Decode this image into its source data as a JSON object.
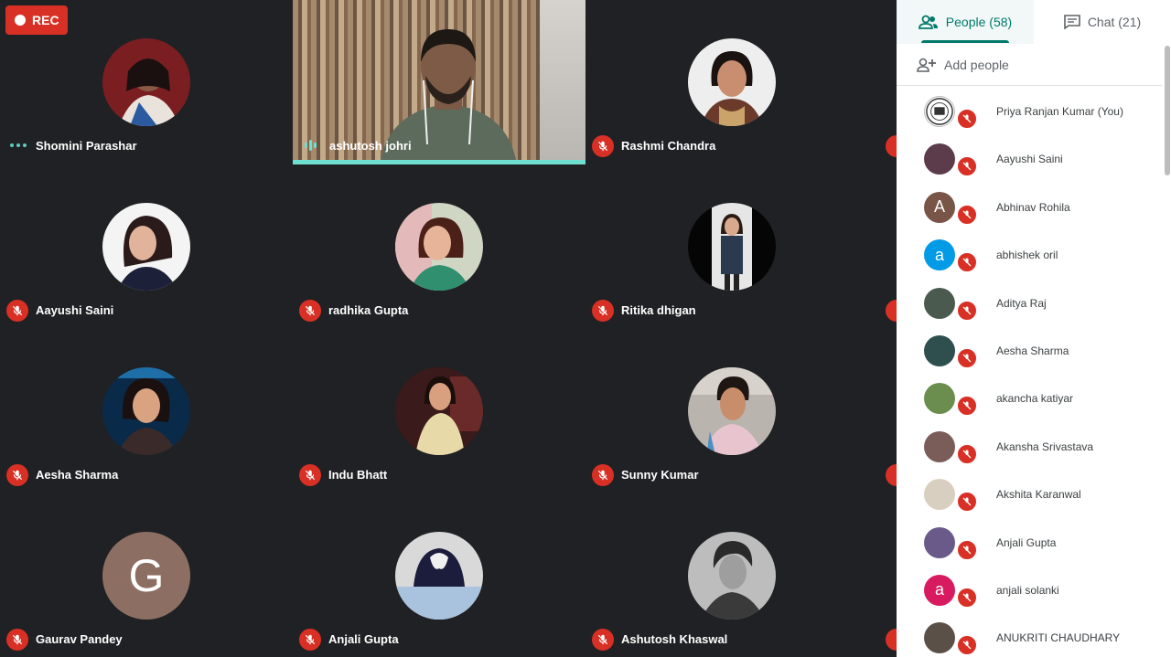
{
  "recording": {
    "label": "REC"
  },
  "grid": {
    "tiles": [
      {
        "name": "Shomini Parashar",
        "status": "dots"
      },
      {
        "name": "ashutosh johri",
        "status": "speaking"
      },
      {
        "name": "Rashmi Chandra",
        "status": "muted"
      },
      {
        "name": "Aayushi Saini",
        "status": "muted"
      },
      {
        "name": "radhika Gupta",
        "status": "muted"
      },
      {
        "name": "Ritika dhigan",
        "status": "muted"
      },
      {
        "name": "Aesha Sharma",
        "status": "muted"
      },
      {
        "name": "Indu Bhatt",
        "status": "muted"
      },
      {
        "name": "Sunny Kumar",
        "status": "muted"
      },
      {
        "name": "Gaurav Pandey",
        "status": "muted",
        "initial": "G",
        "color": "#8d6e63"
      },
      {
        "name": "Anjali Gupta",
        "status": "muted"
      },
      {
        "name": "Ashutosh Khaswal",
        "status": "muted"
      }
    ]
  },
  "panel": {
    "tabs": {
      "people": "People (58)",
      "chat": "Chat (21)"
    },
    "add_people": "Add people",
    "participants": [
      {
        "name": "Priya Ranjan Kumar (You)",
        "avatar": "logo"
      },
      {
        "name": "Aayushi Saini",
        "avatar": "photo",
        "color": "#5c3b4a"
      },
      {
        "name": "Abhinav Rohila",
        "avatar": "initial",
        "initial": "A",
        "color": "#795548"
      },
      {
        "name": "abhishek oril",
        "avatar": "initial",
        "initial": "a",
        "color": "#039be5"
      },
      {
        "name": "Aditya Raj",
        "avatar": "photo",
        "color": "#4a5a4f"
      },
      {
        "name": "Aesha Sharma",
        "avatar": "photo",
        "color": "#2f4f4f"
      },
      {
        "name": "akancha katiyar",
        "avatar": "photo",
        "color": "#6b8e4e"
      },
      {
        "name": "Akansha Srivastava",
        "avatar": "photo",
        "color": "#7a5c58"
      },
      {
        "name": "Akshita Karanwal",
        "avatar": "photo",
        "color": "#d8cfc0"
      },
      {
        "name": "Anjali Gupta",
        "avatar": "photo",
        "color": "#6a5a8a"
      },
      {
        "name": "anjali solanki",
        "avatar": "initial",
        "initial": "a",
        "color": "#d81b60"
      },
      {
        "name": "ANUKRITI CHAUDHARY",
        "avatar": "photo",
        "color": "#5a5048"
      }
    ]
  },
  "colors": {
    "accent": "#00796b",
    "muted": "#d93025",
    "speaking": "#6fe0cf"
  }
}
